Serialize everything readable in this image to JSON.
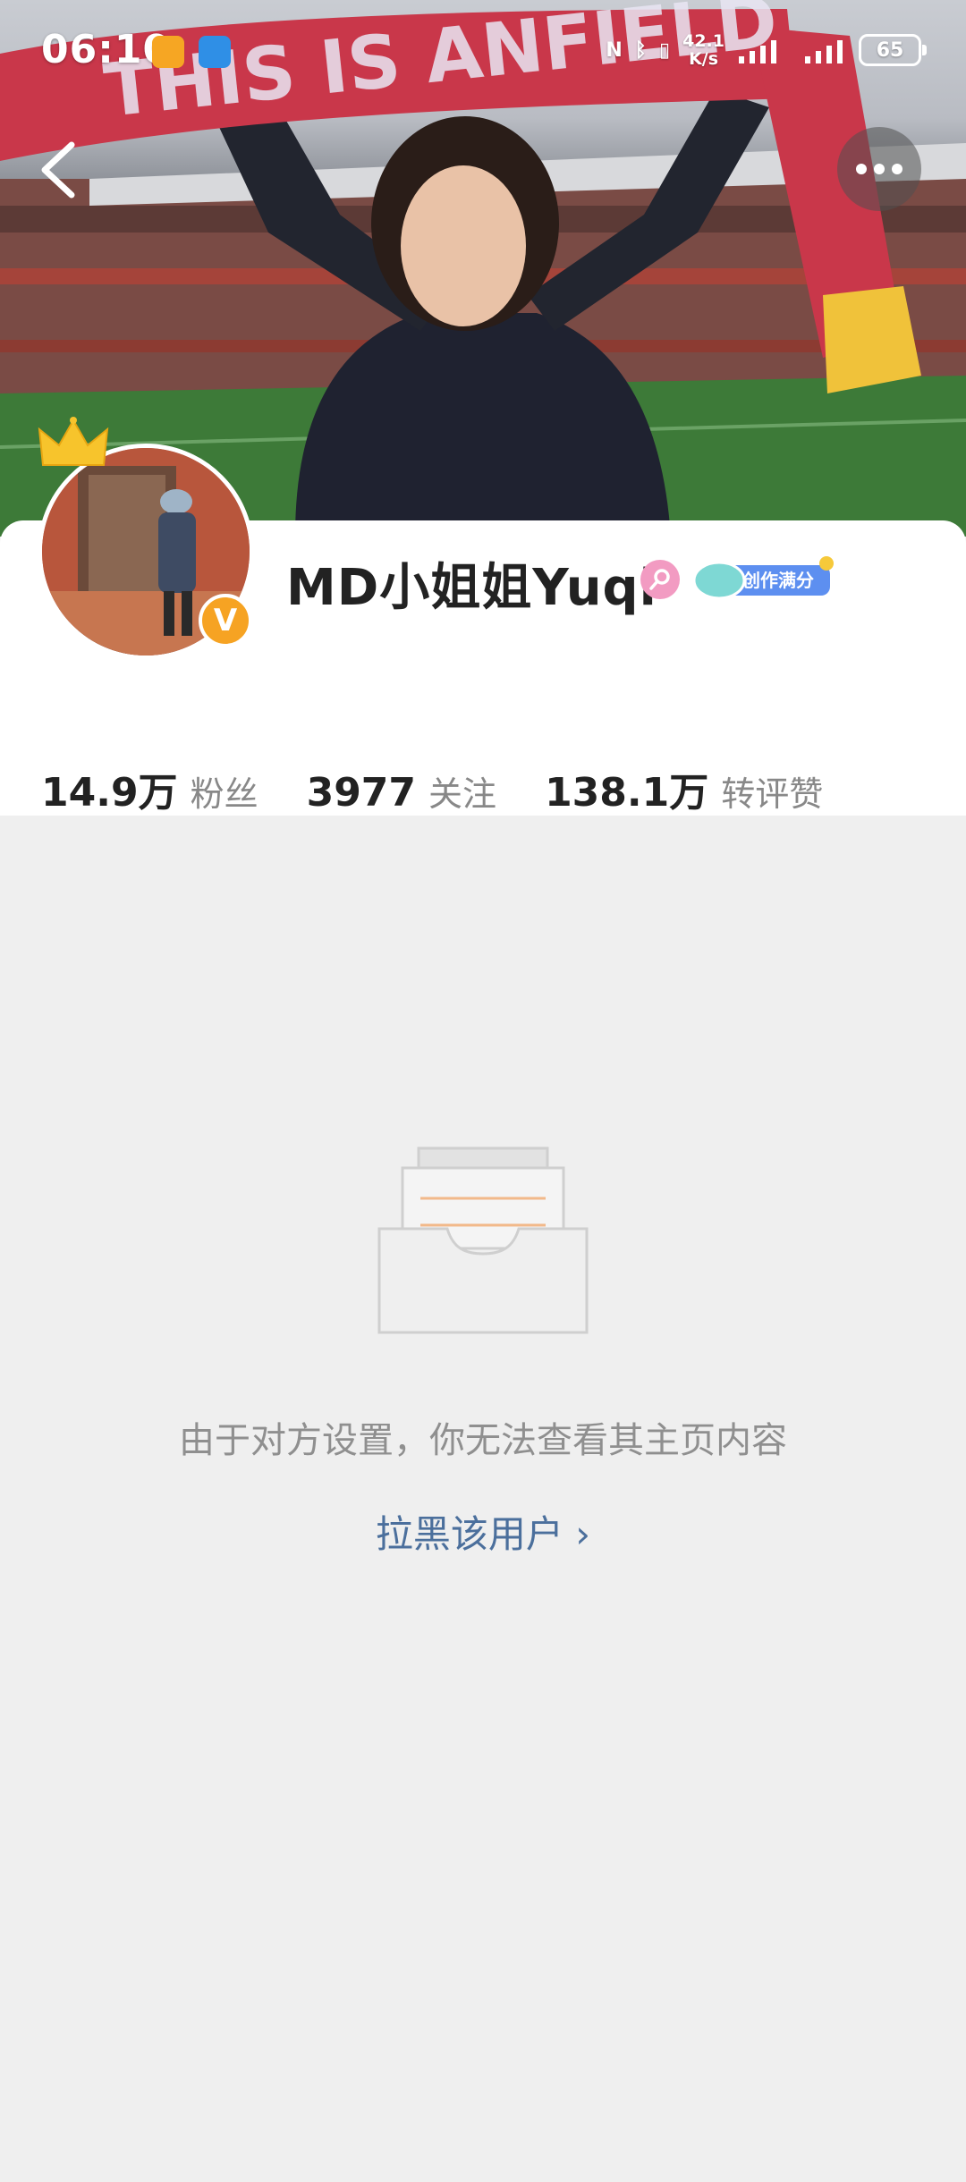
{
  "status_bar": {
    "time": "06:10",
    "net_speed_value": "42.1",
    "net_speed_unit": "K/s",
    "battery": "65"
  },
  "cover": {
    "banner_text": "THIS IS ANFIELD"
  },
  "profile": {
    "name": "MD小姐姐Yuqi",
    "gender_icon": "female-icon",
    "badge_label": "创作满分",
    "verified_icon": "v-verified-icon",
    "stats": [
      {
        "value": "14.9万",
        "label": "粉丝"
      },
      {
        "value": "3977",
        "label": "关注"
      },
      {
        "value": "138.1万",
        "label": "转评赞"
      }
    ]
  },
  "empty_state": {
    "message": "由于对方设置，你无法查看其主页内容",
    "block_link": "拉黑该用户",
    "block_link_chevron": "›"
  },
  "colors": {
    "background": "#efefef",
    "link": "#4b6f9c",
    "verified_badge": "#f6a323",
    "female_badge": "#f29bc2"
  }
}
